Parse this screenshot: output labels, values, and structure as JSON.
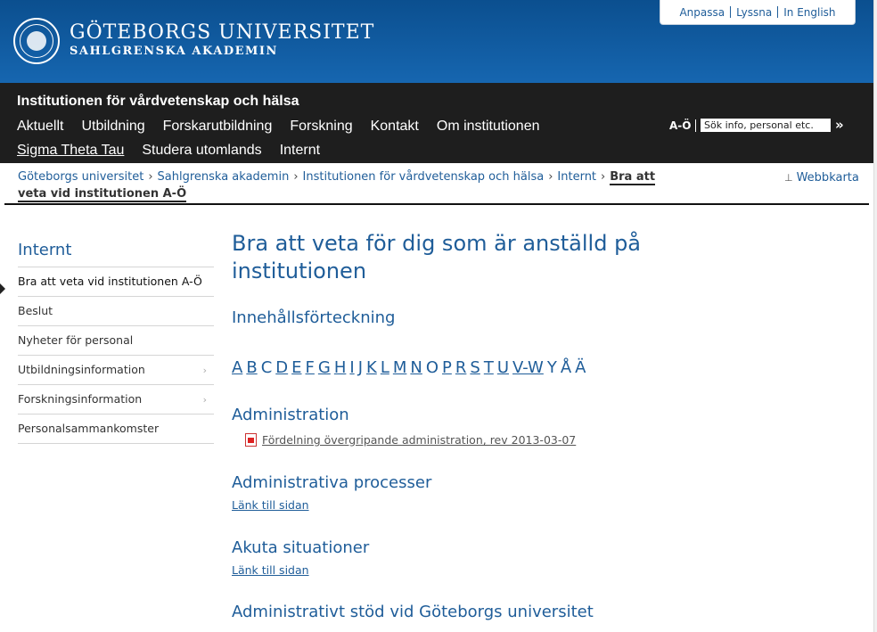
{
  "header": {
    "university": "GÖTEBORGS UNIVERSITET",
    "academy": "SAHLGRENSKA AKADEMIN",
    "toplinks": [
      "Anpassa",
      "Lyssna",
      "In English"
    ]
  },
  "nav": {
    "department": "Institutionen för vårdvetenskap och hälsa",
    "row1": [
      "Aktuellt",
      "Utbildning",
      "Forskarutbildning",
      "Forskning",
      "Kontakt",
      "Om institutionen"
    ],
    "row2": [
      "Sigma Theta Tau",
      "Studera utomlands",
      "Internt"
    ],
    "ao_label": "A-Ö",
    "search_placeholder": "Sök info, personal etc.",
    "search_go": "»"
  },
  "breadcrumb": {
    "items": [
      "Göteborgs universitet",
      "Sahlgrenska akademin",
      "Institutionen för vårdvetenskap och hälsa",
      "Internt"
    ],
    "current": "Bra att veta vid institutionen A-Ö",
    "sitemap": "Webbkarta"
  },
  "sidebar": {
    "title": "Internt",
    "items": [
      {
        "label": "Bra att veta vid institutionen A-Ö",
        "current": true
      },
      {
        "label": "Beslut"
      },
      {
        "label": "Nyheter för personal"
      },
      {
        "label": "Utbildningsinformation",
        "arrow": "›"
      },
      {
        "label": "Forskningsinformation",
        "arrow": "›"
      },
      {
        "label": "Personalsammankomster"
      }
    ]
  },
  "main": {
    "title": "Bra att veta för dig som är anställd på institutionen",
    "toc_heading": "Innehållsförteckning",
    "alphabet": [
      {
        "t": "A",
        "link": true
      },
      {
        "t": "B",
        "link": true
      },
      {
        "t": "C",
        "link": false
      },
      {
        "t": "D",
        "link": true
      },
      {
        "t": "E",
        "link": true
      },
      {
        "t": "F",
        "link": true
      },
      {
        "t": "G",
        "link": true
      },
      {
        "t": "H",
        "link": true
      },
      {
        "t": "I",
        "link": true
      },
      {
        "t": "J",
        "link": false
      },
      {
        "t": "K",
        "link": true
      },
      {
        "t": "L",
        "link": true
      },
      {
        "t": "M",
        "link": true
      },
      {
        "t": "N",
        "link": true
      },
      {
        "t": "O",
        "link": false
      },
      {
        "t": "P",
        "link": true
      },
      {
        "t": "R",
        "link": true
      },
      {
        "t": "S",
        "link": true
      },
      {
        "t": "T",
        "link": true
      },
      {
        "t": "U",
        "link": true
      },
      {
        "t": "V-W",
        "link": true
      },
      {
        "t": "Y",
        "link": false
      },
      {
        "t": "Å",
        "link": false
      },
      {
        "t": "Ä",
        "link": false
      }
    ],
    "sections": {
      "admin_heading": "Administration",
      "admin_doc": "Fördelning övergripande administration, rev 2013-03-07",
      "processes_heading": "Administrativa processer",
      "processes_link": "Länk till sidan",
      "acute_heading": "Akuta situationer",
      "acute_link": "Länk till sidan",
      "support_heading": "Administrativt stöd vid Göteborgs universitet"
    }
  }
}
